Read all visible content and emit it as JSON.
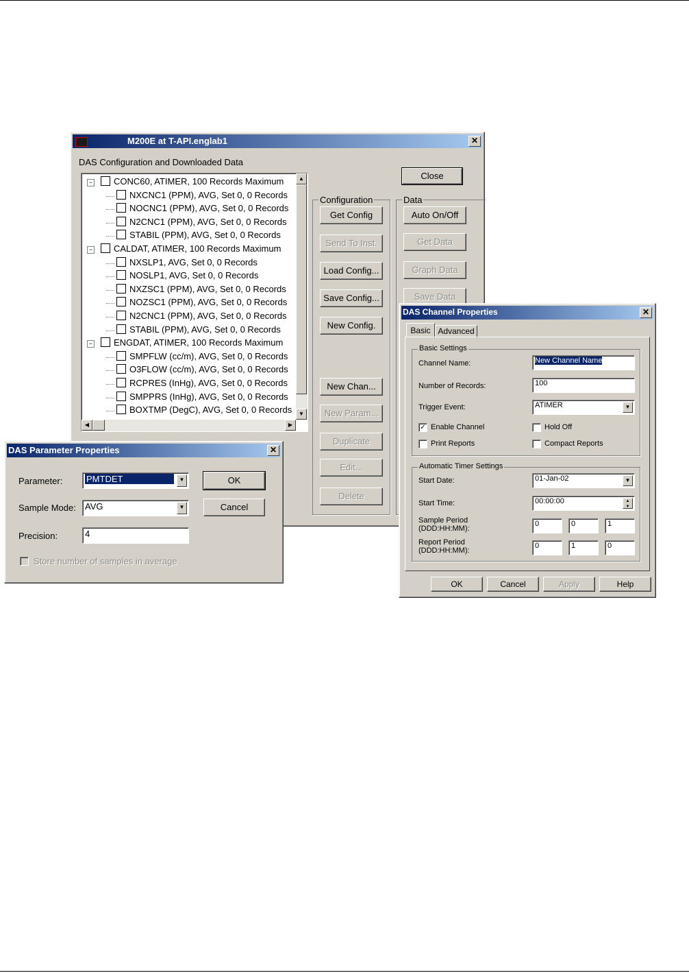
{
  "main_window": {
    "title": "M200E   at T-API.englab1",
    "subtitle": "DAS Configuration and Downloaded Data",
    "close_label": "Close",
    "config_group": "Configuration",
    "data_group": "Data",
    "config_buttons": [
      "Get Config",
      "Send To Inst.",
      "Load Config...",
      "Save Config...",
      "New Config."
    ],
    "data_buttons": [
      "Auto On/Off",
      "Get Data",
      "Graph Data",
      "Save Data"
    ],
    "edit_buttons": [
      "New Chan...",
      "New Param...",
      "Duplicate",
      "Edit...",
      "Delete"
    ],
    "tree": [
      {
        "level": 0,
        "text": "CONC60, ATIMER, 100 Records Maximum"
      },
      {
        "level": 1,
        "text": "NXCNC1 (PPM), AVG, Set 0, 0 Records"
      },
      {
        "level": 1,
        "text": "NOCNC1 (PPM), AVG, Set 0, 0 Records"
      },
      {
        "level": 1,
        "text": "N2CNC1 (PPM), AVG, Set 0, 0 Records"
      },
      {
        "level": 1,
        "text": "STABIL (PPM), AVG, Set 0, 0 Records"
      },
      {
        "level": 0,
        "text": "CALDAT, ATIMER, 100 Records Maximum"
      },
      {
        "level": 1,
        "text": "NXSLP1, AVG, Set 0, 0 Records"
      },
      {
        "level": 1,
        "text": "NOSLP1, AVG, Set 0, 0 Records"
      },
      {
        "level": 1,
        "text": "NXZSC1 (PPM), AVG, Set 0, 0 Records"
      },
      {
        "level": 1,
        "text": "NOZSC1 (PPM), AVG, Set 0, 0 Records"
      },
      {
        "level": 1,
        "text": "N2CNC1 (PPM), AVG, Set 0, 0 Records"
      },
      {
        "level": 1,
        "text": "STABIL (PPM), AVG, Set 0, 0 Records"
      },
      {
        "level": 0,
        "text": "ENGDAT, ATIMER, 100 Records Maximum"
      },
      {
        "level": 1,
        "text": "SMPFLW (cc/m), AVG, Set 0, 0 Records"
      },
      {
        "level": 1,
        "text": "O3FLOW (cc/m), AVG, Set 0, 0 Records"
      },
      {
        "level": 1,
        "text": "RCPRES (InHg), AVG, Set 0, 0 Records"
      },
      {
        "level": 1,
        "text": "SMPPRS (InHg), AVG, Set 0, 0 Records"
      },
      {
        "level": 1,
        "text": "BOXTMP (DegC), AVG, Set 0, 0 Records"
      }
    ]
  },
  "param_dialog": {
    "title": "DAS Parameter Properties",
    "parameter_label": "Parameter:",
    "parameter_value": "PMTDET",
    "sample_mode_label": "Sample Mode:",
    "sample_mode_value": "AVG",
    "precision_label": "Precision:",
    "precision_value": "4",
    "store_label": "Store number of samples in average",
    "ok_label": "OK",
    "cancel_label": "Cancel"
  },
  "channel_dialog": {
    "title": "DAS Channel Properties",
    "tabs": [
      "Basic",
      "Advanced"
    ],
    "basic_group": "Basic Settings",
    "channel_name_label": "Channel Name:",
    "channel_name_value": "New Channel Name",
    "num_records_label": "Number of Records:",
    "num_records_value": "100",
    "trigger_label": "Trigger Event:",
    "trigger_value": "ATIMER",
    "enable_label": "Enable Channel",
    "hold_off_label": "Hold Off",
    "print_label": "Print Reports",
    "compact_label": "Compact Reports",
    "timer_group": "Automatic Timer Settings",
    "start_date_label": "Start Date:",
    "start_date_value": "01-Jan-02",
    "start_time_label": "Start Time:",
    "start_time_value": "00:00:00",
    "sample_period_label": "Sample Period",
    "report_period_label": "Report Period",
    "period_format": "(DDD:HH:MM):",
    "sample_period_values": [
      "0",
      "0",
      "1"
    ],
    "report_period_values": [
      "0",
      "1",
      "0"
    ],
    "buttons": [
      "OK",
      "Cancel",
      "Apply",
      "Help"
    ]
  }
}
